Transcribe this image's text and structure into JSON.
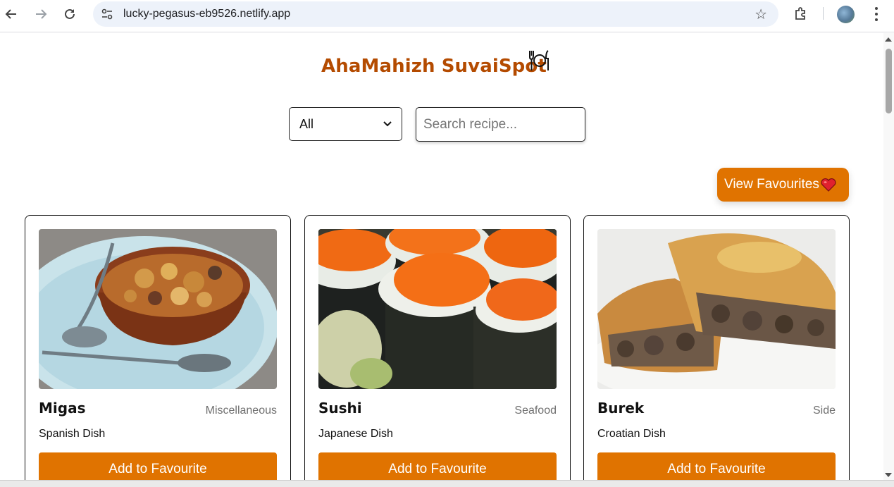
{
  "browser": {
    "url": "lucky-pegasus-eb9526.netlify.app",
    "icons": {
      "back": "arrow-left-icon",
      "forward": "arrow-right-icon",
      "reload": "reload-icon",
      "site_info": "site-info-icon",
      "bookmark": "star-icon",
      "extensions": "puzzle-icon",
      "menu": "kebab-menu-icon"
    }
  },
  "header": {
    "title": "AhaMahizh SuvaiSpot",
    "title_color": "#b44b00",
    "logo_icon": "plate-cutlery-icon"
  },
  "filters": {
    "category_selected": "All",
    "search_placeholder": "Search recipe...",
    "search_value": ""
  },
  "favourites_button": {
    "label": "View Favourites",
    "icon": "heart-icon",
    "color": "#e07300"
  },
  "recipes": [
    {
      "name": "Migas",
      "category": "Miscellaneous",
      "area": "Spanish Dish",
      "button_label": "Add to Favourite"
    },
    {
      "name": "Sushi",
      "category": "Seafood",
      "area": "Japanese Dish",
      "button_label": "Add to Favourite"
    },
    {
      "name": "Burek",
      "category": "Side",
      "area": "Croatian Dish",
      "button_label": "Add to Favourite"
    }
  ],
  "colors": {
    "accent": "#e07300",
    "title": "#b44b00"
  }
}
